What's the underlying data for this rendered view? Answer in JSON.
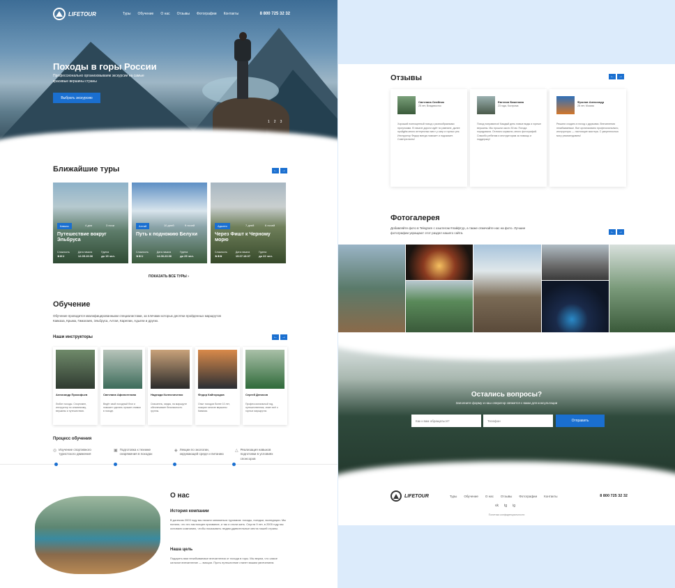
{
  "brand": {
    "logo": "LIFETOUR",
    "phone": "8 800 725 32 32"
  },
  "nav": [
    "Туры",
    "Обучение",
    "О нас",
    "Отзывы",
    "Фотографии",
    "Контакты"
  ],
  "hero": {
    "title": "Походы в горы России",
    "subtitle": "Профессионально организовываем экскурсии на самые красивые вершины страны",
    "button": "Выбрать экскурсию",
    "pager": [
      "1",
      "2",
      "3"
    ]
  },
  "tours": {
    "title": "Ближайшие туры",
    "arrows": [
      "←",
      "→"
    ],
    "items": [
      {
        "region": "Кавказ",
        "days": "4 дня",
        "nights": "3 ночи",
        "name": "Путешествие вокруг Эльбруса",
        "difficulty_label": "Сложность",
        "difficulty": "★★☆",
        "date_label": "Дата начала",
        "date": "12.05.19.06",
        "group_label": "Группа",
        "group": "до 15 чел."
      },
      {
        "region": "Алтай",
        "days": "10 дней",
        "nights": "9 ночей",
        "name": "Путь к подножию Белухи",
        "difficulty_label": "Сложность",
        "difficulty": "★★☆",
        "date_label": "Дата начала",
        "date": "14.06.23.06",
        "group_label": "Группа",
        "group": "до 25 чел."
      },
      {
        "region": "Адыгея",
        "days": "7 дней",
        "nights": "6 ночей",
        "name": "Через Фишт к Черному морю",
        "difficulty_label": "Сложность",
        "difficulty": "★★★",
        "date_label": "Дата начала",
        "date": "15.07.18.07",
        "group_label": "Группа",
        "group": "до 22 чел."
      }
    ],
    "show_all": "ПОКАЗАТЬ ВСЕ ТУРЫ ›"
  },
  "education": {
    "title": "Обучение",
    "text": "Обучение проводится квалифицированными специалистами, за плечами которых десятки пройденных маршрутов Кавказа, Крыма, Гималаев, Эльбруса, Алтая, Карелии, Адыгеи и других.",
    "instructors_title": "Наши инструкторы",
    "arrows": [
      "←",
      "→"
    ],
    "instructors": [
      {
        "name": "Александр Прокофьев",
        "desc": "Любит походы. Спортсмен, инструктор по альпинизму, вершины и путешествия."
      },
      {
        "name": "Светлана Афиногенова",
        "desc": "Ведёт свой походный блог и поможет сделать лучшие снимки в походе."
      },
      {
        "name": "Надежда Колесниченко",
        "desc": "Спасатель, медик, на маршруте обеспечивает безопасность группы."
      },
      {
        "name": "Федор Кайгородов",
        "desc": "Опыт походов более 10 лет, покорил многие вершины Кавказа."
      },
      {
        "name": "Сергей Денисов",
        "desc": "Профессиональный гид, путешественник, знает всё о горных маршрутах."
      }
    ],
    "process_title": "Процесс обучения",
    "steps": [
      {
        "icon": "◎",
        "label": "Изучение спортивного туристского движения"
      },
      {
        "icon": "▣",
        "label": "Подготовка к технике снаряжения в походах"
      },
      {
        "icon": "◈",
        "label": "Лекции по экологии, окружающей среде и питанию"
      },
      {
        "icon": "△",
        "label": "Реализация навыков подготовки в условиях спонсоров"
      }
    ]
  },
  "about": {
    "title": "О нас",
    "history_title": "История компании",
    "history": "В далеком 2003 году мы начали заниматься туризмом: походы, поездки, экспедиции. Мы поняли, что это настоящее призвание, и так и стали жить. Спустя 9 лет, в 2005 году мы основали компанию, чтобы показывать людям удивительные места нашей страны.",
    "goal_title": "Наша цель",
    "goal": "Подарить вам незабываемые впечатления от похода в горы. Мы верим, что самое сильное впечатление — эмоции. Пусть путешествие станет вашим увлечением."
  },
  "reviews": {
    "title": "Отзывы",
    "arrows": [
      "←",
      "→"
    ],
    "items": [
      {
        "name": "Светлана Олейник",
        "age": "25 лет, Владивосток",
        "text": "Хороший полноценный поход с разнообразными прогулками. В начале дороги идёт по равнине, далее пройдём много интересных мест у озер и горных рек. Инструктор Федор всегда поможет и подскажет. Советую всем!"
      },
      {
        "name": "Евгения Баженова",
        "age": "23 года, Кострома",
        "text": "Поход понравился! Каждый день новые виды и горные вершины. Мы прошли около 30 км. Погода порадовала. Отлично кормили, много фотографий. Спасибо ребятам и инструкторам за помощь и поддержку!"
      },
      {
        "name": "Фролов Александр",
        "age": "28 лет, Москва",
        "text": "Решили сходить в поход с друзьями. Впечатления незабываемые. Все организовано профессионально, инструкторы — настоящие мастера. С уверенностью могу рекомендовать!"
      }
    ]
  },
  "gallery": {
    "title": "Фотогалерея",
    "text": "Добавляйте фото в Telegram с хэштегом #лайфтур, а также отмечайте нас на фото. Лучшие фотографии укращают этот раздел нашего сайта.",
    "arrows": [
      "←",
      "→"
    ]
  },
  "contact": {
    "title": "Остались вопросы?",
    "subtitle": "Заполните форму и наш оператор свяжется с вами для консультации",
    "name_placeholder": "Как к вам обращаться?",
    "phone_placeholder": "Телефон",
    "button": "Отправить"
  },
  "footer": {
    "social": [
      "vk",
      "tg",
      "ig"
    ],
    "policy": "Политика конфиденциальности"
  },
  "colors": {
    "accent": "#1a6fd0",
    "page_bg": "#dcebfb"
  }
}
